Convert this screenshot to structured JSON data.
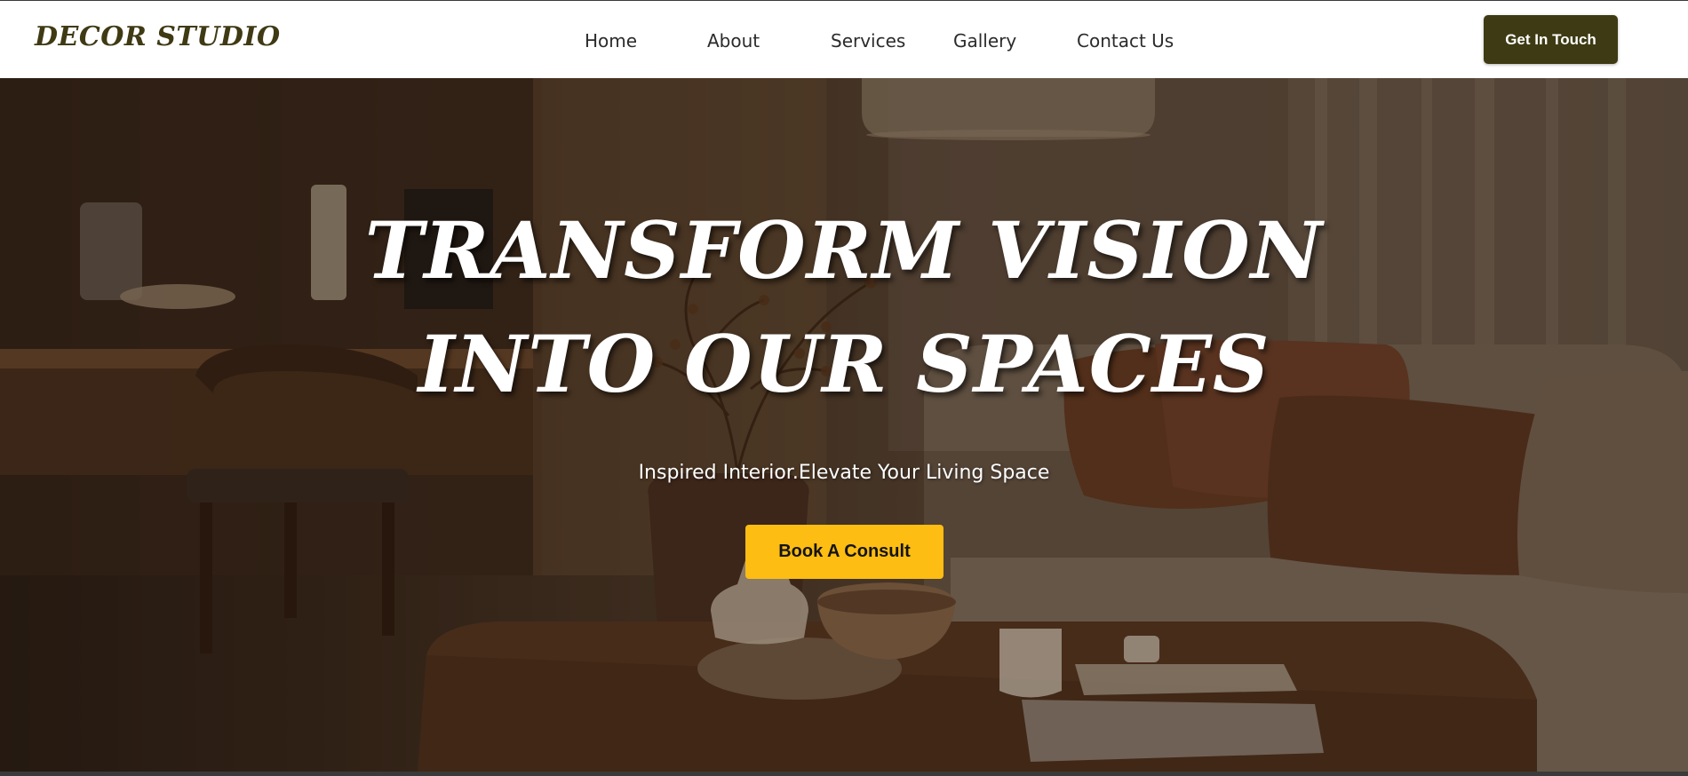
{
  "brand": {
    "logo_text": "DECOR STUDIO"
  },
  "nav": {
    "items": [
      {
        "label": "Home"
      },
      {
        "label": "About"
      },
      {
        "label": "Services"
      },
      {
        "label": "Gallery"
      },
      {
        "label": "Contact Us"
      }
    ],
    "cta_label": "Get In Touch"
  },
  "hero": {
    "title_line1": "TRANSFORM VISION",
    "title_line2": "INTO OUR SPACES",
    "subtitle": "Inspired Interior.Elevate Your Living Space",
    "cta_label": "Book A Consult"
  },
  "colors": {
    "brand_dark": "#3e3a13",
    "accent_yellow": "#fdbd12",
    "nav_background": "#ffffff"
  }
}
